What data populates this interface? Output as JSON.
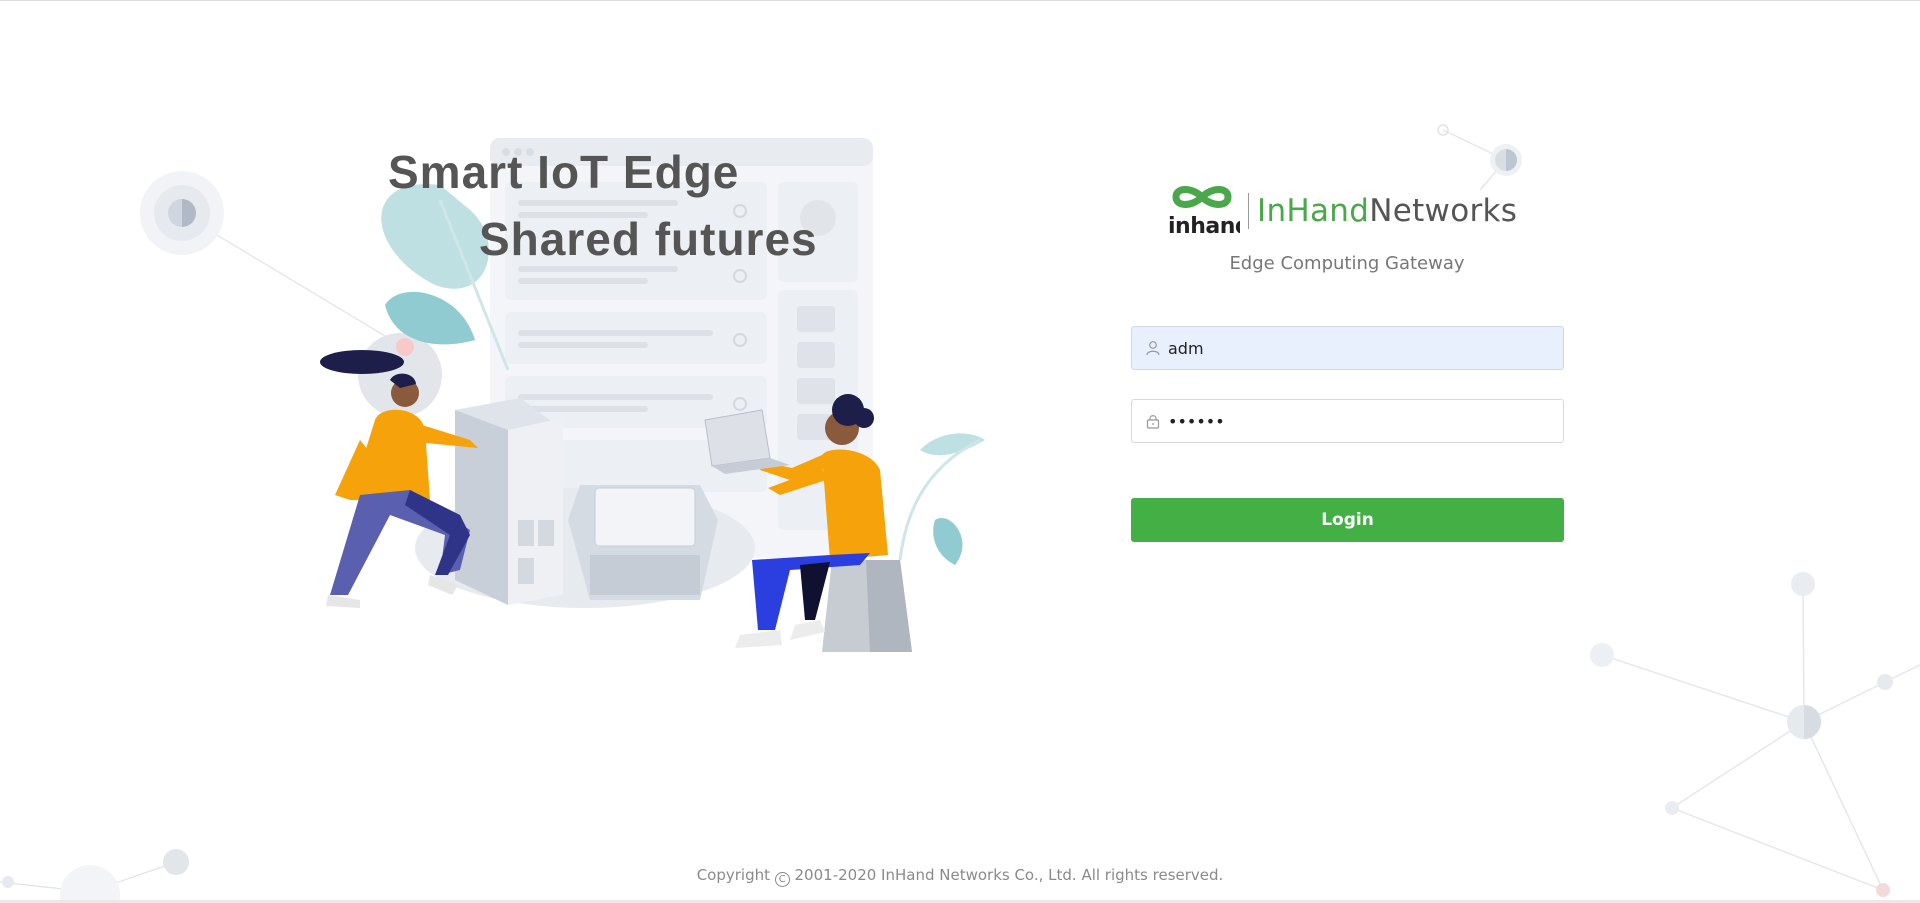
{
  "hero": {
    "slogan_line1": "Smart IoT Edge",
    "slogan_line2": "Shared futures",
    "illustration": "people-with-iot-devices-illustration"
  },
  "brand": {
    "logo_name": "inhand-logo",
    "wordmark_in": "InHand",
    "wordmark_networks": "Networks",
    "accent_color": "#4aa84a"
  },
  "login_form": {
    "product_name": "Edge Computing Gateway",
    "username": {
      "value": "adm",
      "icon": "user-icon"
    },
    "password": {
      "value": "••••••",
      "icon": "lock-icon"
    },
    "login_label": "Login",
    "login_color": "#42b045"
  },
  "footer": {
    "copyright_symbol": "C",
    "copyright_text": " 2001-2020 InHand Networks Co., Ltd. All rights reserved."
  }
}
